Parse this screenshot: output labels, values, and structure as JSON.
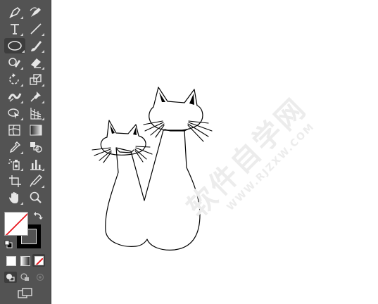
{
  "toolbar": {
    "tools": [
      {
        "name": "pen-tool-icon",
        "icon": "pen"
      },
      {
        "name": "curvature-tool-icon",
        "icon": "curvature"
      },
      {
        "name": "type-tool-icon",
        "icon": "type",
        "glyph": "T"
      },
      {
        "name": "line-segment-tool-icon",
        "icon": "line"
      },
      {
        "name": "ellipse-tool-icon",
        "icon": "ellipse",
        "active": true
      },
      {
        "name": "paintbrush-tool-icon",
        "icon": "brush"
      },
      {
        "name": "shaper-tool-icon",
        "icon": "shaper"
      },
      {
        "name": "eraser-tool-icon",
        "icon": "eraser"
      },
      {
        "name": "rotate-tool-icon",
        "icon": "rotate"
      },
      {
        "name": "scale-tool-icon",
        "icon": "scale"
      },
      {
        "name": "width-tool-icon",
        "icon": "width"
      },
      {
        "name": "puppet-warp-tool-icon",
        "icon": "pin"
      },
      {
        "name": "shape-builder-tool-icon",
        "icon": "shapebuilder"
      },
      {
        "name": "perspective-grid-tool-icon",
        "icon": "perspective"
      },
      {
        "name": "mesh-tool-icon",
        "icon": "mesh"
      },
      {
        "name": "gradient-tool-icon",
        "icon": "gradient"
      },
      {
        "name": "eyedropper-tool-icon",
        "icon": "eyedropper"
      },
      {
        "name": "blend-tool-icon",
        "icon": "blend"
      },
      {
        "name": "symbol-sprayer-tool-icon",
        "icon": "sprayer"
      },
      {
        "name": "column-graph-tool-icon",
        "icon": "graph"
      },
      {
        "name": "artboard-tool-icon",
        "icon": "artboard"
      },
      {
        "name": "slice-tool-icon",
        "icon": "slice"
      },
      {
        "name": "hand-tool-icon",
        "icon": "hand"
      },
      {
        "name": "zoom-tool-icon",
        "icon": "zoom"
      }
    ],
    "fill_color": "#ffffff",
    "stroke_color": "#000000",
    "fill_none_color": "#e8141c"
  },
  "watermark": {
    "text": "软件自学网",
    "url": "WWW.RJZXW.COM"
  }
}
